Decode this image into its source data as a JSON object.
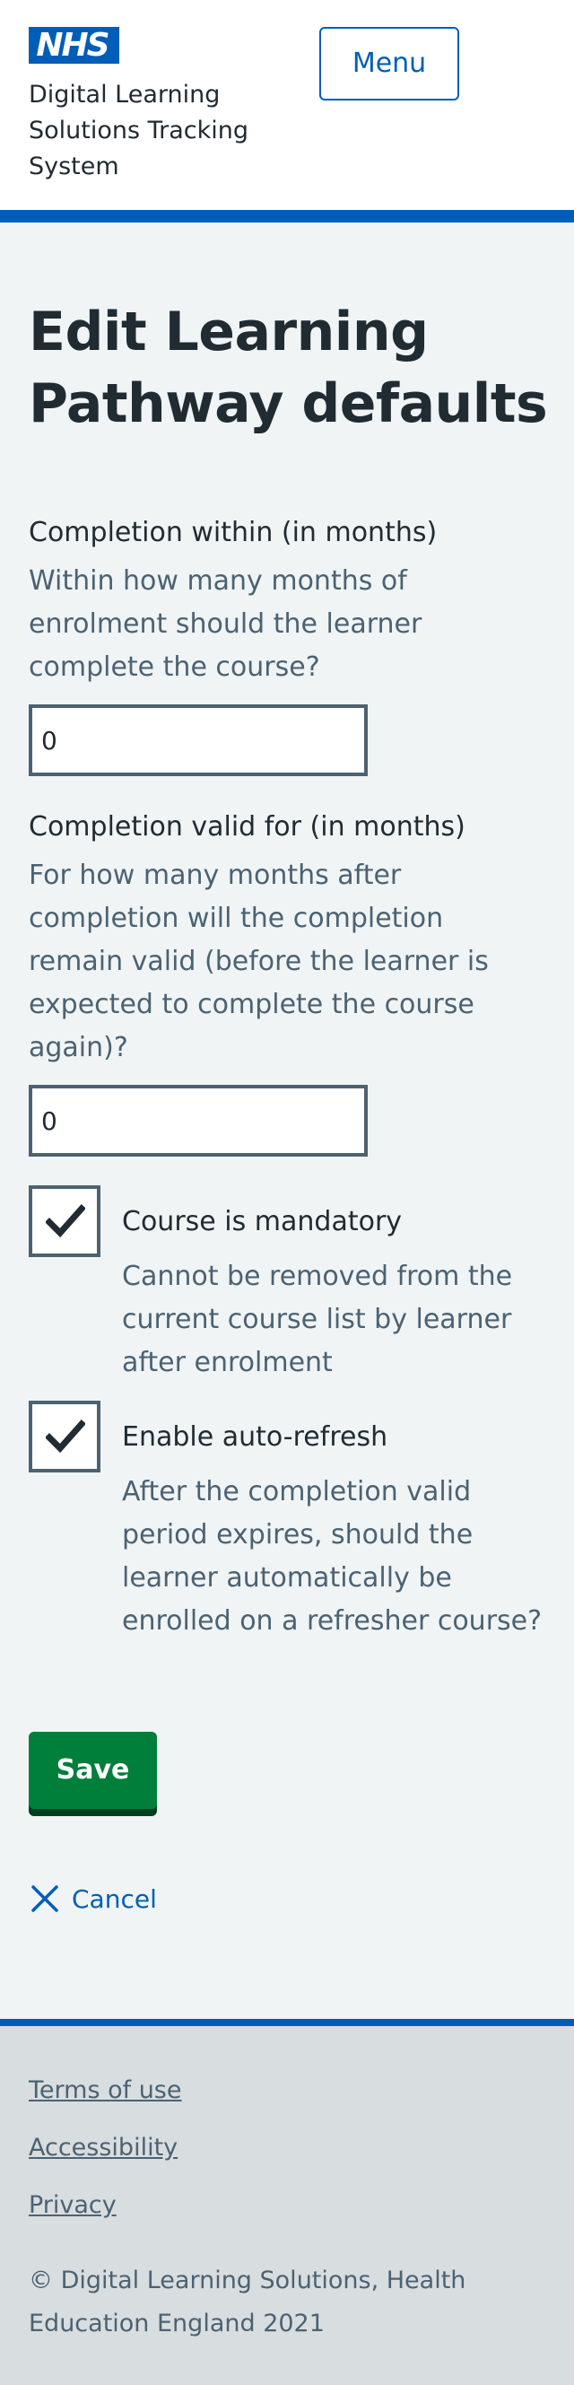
{
  "header": {
    "logo_text": "NHS",
    "service_name": "Digital Learning Solutions Tracking System",
    "menu_label": "Menu"
  },
  "main": {
    "title": "Edit Learning Pathway defaults",
    "completion_within": {
      "label": "Completion within (in months)",
      "hint": "Within how many months of enrolment should the learner complete the course?",
      "value": "0"
    },
    "completion_valid_for": {
      "label": "Completion valid for (in months)",
      "hint": "For how many months after completion will the completion remain valid (before the learner is expected to complete the course again)?",
      "value": "0"
    },
    "mandatory": {
      "label": "Course is mandatory",
      "hint": "Cannot be removed from the current course list by learner after enrolment",
      "checked": true
    },
    "auto_refresh": {
      "label": "Enable auto-refresh",
      "hint": "After the completion valid period expires, should the learner automatically be enrolled on a refresher course?",
      "checked": true
    },
    "save_label": "Save",
    "cancel_label": "Cancel"
  },
  "footer": {
    "links": [
      "Terms of use",
      "Accessibility",
      "Privacy"
    ],
    "copyright": "© Digital Learning Solutions, Health Education England 2021"
  },
  "colors": {
    "nhs_blue": "#005eb8",
    "page_background": "#f0f4f5",
    "button_green": "#007f3b",
    "footer_background": "#d8dde0",
    "text": "#212b32",
    "secondary_text": "#4c6272"
  },
  "icons": {
    "menu": "none",
    "checkbox_tick": "tick-icon",
    "cancel": "cross-icon"
  }
}
